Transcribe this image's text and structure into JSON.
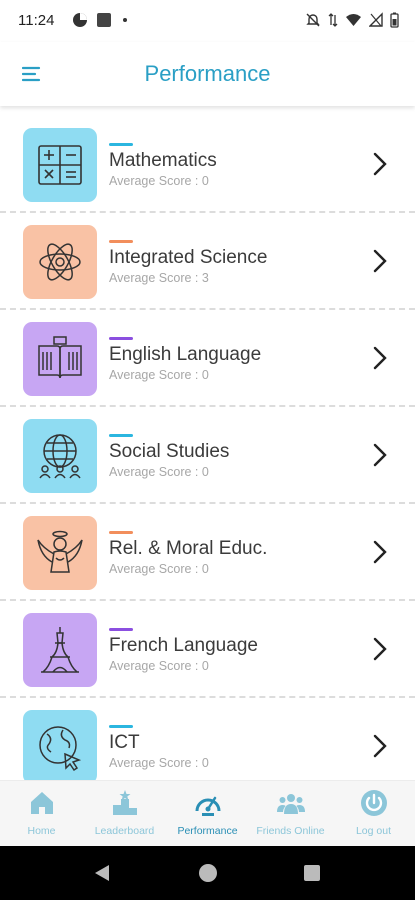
{
  "status_bar": {
    "time": "11:24",
    "icons_left": [
      "app-circle-icon",
      "app-square-icon",
      "dot-icon"
    ],
    "icons_right": [
      "bell-off-icon",
      "data-arrows-icon",
      "wifi-icon",
      "signal-icon",
      "battery-icon"
    ]
  },
  "appbar": {
    "title": "Performance",
    "menu_icon": "menu-icon"
  },
  "subjects": [
    {
      "name": "Mathematics",
      "score": "Average Score : 0",
      "tile_color": "#8fdcf2",
      "accent_color": "#2bb6e0",
      "icon": "math-symbols-icon"
    },
    {
      "name": "Integrated Science",
      "score": "Average Score : 3",
      "tile_color": "#f9c2a5",
      "accent_color": "#f28e5c",
      "icon": "atom-icon"
    },
    {
      "name": "English Language",
      "score": "Average Score : 0",
      "tile_color": "#c7a6f3",
      "accent_color": "#8b4fe0",
      "icon": "book-icon"
    },
    {
      "name": "Social Studies",
      "score": "Average Score : 0",
      "tile_color": "#8fdcf2",
      "accent_color": "#2bb6e0",
      "icon": "globe-people-icon"
    },
    {
      "name": "Rel. & Moral Educ.",
      "score": "Average Score : 0",
      "tile_color": "#f9c2a5",
      "accent_color": "#f28e5c",
      "icon": "angel-icon"
    },
    {
      "name": "French Language",
      "score": "Average Score : 0",
      "tile_color": "#c7a6f3",
      "accent_color": "#8b4fe0",
      "icon": "eiffel-tower-icon"
    },
    {
      "name": "ICT",
      "score": "Average Score : 0",
      "tile_color": "#8fdcf2",
      "accent_color": "#2bb6e0",
      "icon": "globe-cursor-icon"
    }
  ],
  "bottom_nav": [
    {
      "label": "Home",
      "icon": "home-icon",
      "active": false
    },
    {
      "label": "Leaderboard",
      "icon": "leaderboard-icon",
      "active": false
    },
    {
      "label": "Performance",
      "icon": "gauge-icon",
      "active": true
    },
    {
      "label": "Friends Online",
      "icon": "friends-icon",
      "active": false
    },
    {
      "label": "Log out",
      "icon": "power-icon",
      "active": false
    }
  ],
  "system_nav": [
    "back-icon",
    "home-circle-icon",
    "recents-icon"
  ]
}
